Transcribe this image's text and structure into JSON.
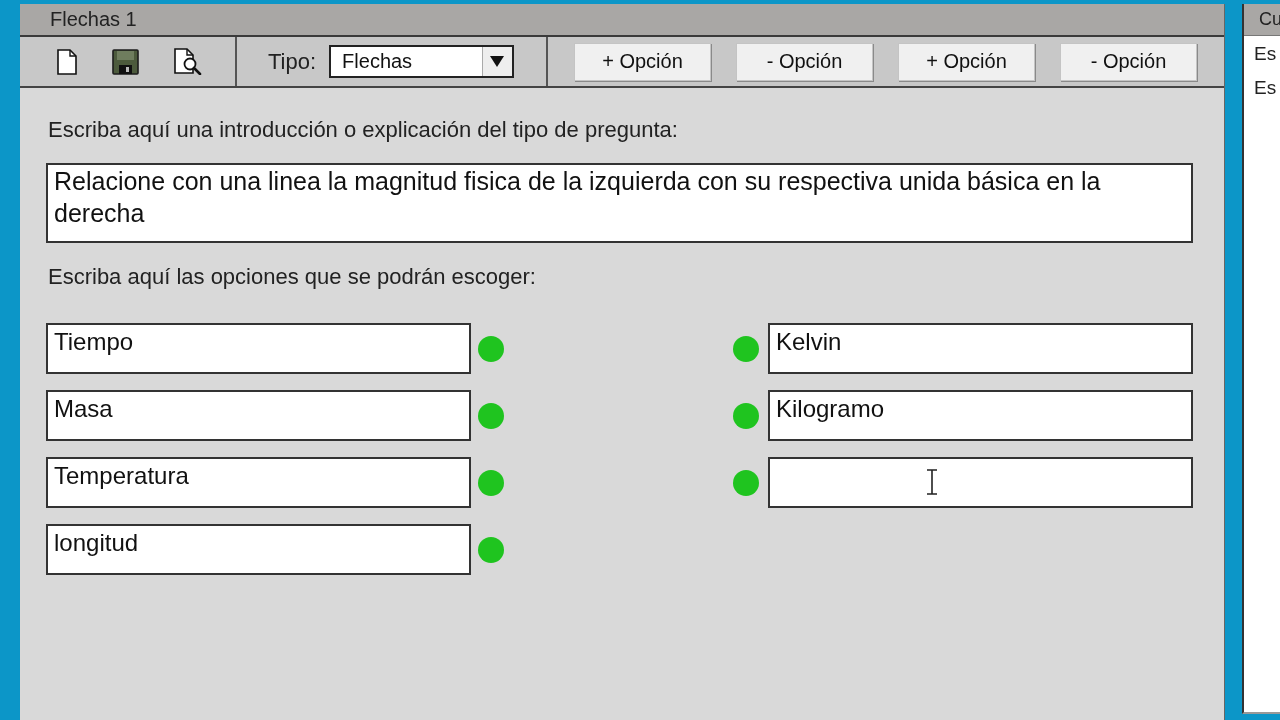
{
  "window": {
    "title": "Flechas 1"
  },
  "toolbar": {
    "type_label": "Tipo:",
    "type_value": "Flechas",
    "buttons": [
      "+ Opción",
      "- Opción",
      "+ Opción",
      "- Opción"
    ]
  },
  "intro": {
    "label": "Escriba aquí una introducción o explicación del tipo de pregunta:",
    "value": "Relacione con una linea la magnitud fisica de la izquierda con su respectiva unida básica en la derecha"
  },
  "options": {
    "label": "Escriba aquí las opciones que se podrán escoger:",
    "left": [
      {
        "value": "Tiempo",
        "hovered": false
      },
      {
        "value": "Masa",
        "hovered": false
      },
      {
        "value": "Temperatura",
        "hovered": false
      },
      {
        "value": "longitud",
        "hovered": false
      }
    ],
    "right": [
      {
        "value": "Kelvin",
        "hovered": false
      },
      {
        "value": "Kilogramo",
        "hovered": false
      },
      {
        "hovered": true
      }
    ]
  },
  "side_panel": {
    "title": "Cu",
    "items": [
      "Es",
      "Es"
    ]
  }
}
